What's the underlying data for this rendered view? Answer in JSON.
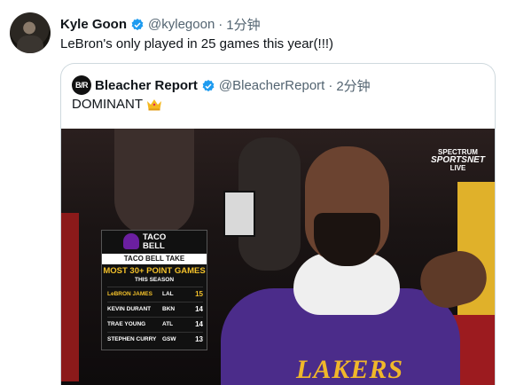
{
  "tweet": {
    "author_name": "Kyle Goon",
    "author_handle": "@kylegoon",
    "separator": "·",
    "time": "1分钟",
    "text": "LeBron's only played in 25 games this year(!!!)"
  },
  "quote": {
    "avatar_label": "B/R",
    "author_name": "Bleacher Report",
    "author_handle": "@BleacherReport",
    "separator": "·",
    "time": "2分钟",
    "text": "DOMINANT",
    "emoji": "crown-icon"
  },
  "media": {
    "network_top": "SPECTRUM",
    "network_mid": "SPORTSNET",
    "network_bot": "LIVE",
    "jersey_text": "LAKERS",
    "graphic": {
      "logo_line1": "TACO",
      "logo_line2": "BELL",
      "banner": "TACO BELL TAKE",
      "title": "MOST 30+ POINT GAMES",
      "subtitle": "THIS SEASON",
      "rows": [
        {
          "player": "LeBRON JAMES",
          "team": "LAL",
          "games": "15"
        },
        {
          "player": "KEVIN DURANT",
          "team": "BKN",
          "games": "14"
        },
        {
          "player": "TRAE YOUNG",
          "team": "ATL",
          "games": "14"
        },
        {
          "player": "STEPHEN CURRY",
          "team": "GSW",
          "games": "13"
        }
      ]
    }
  },
  "colors": {
    "verified_blue": "#1d9bf0",
    "handle_gray": "#536471",
    "lakers_gold": "#f0b72a",
    "lakers_purple": "#4b2c8a"
  }
}
